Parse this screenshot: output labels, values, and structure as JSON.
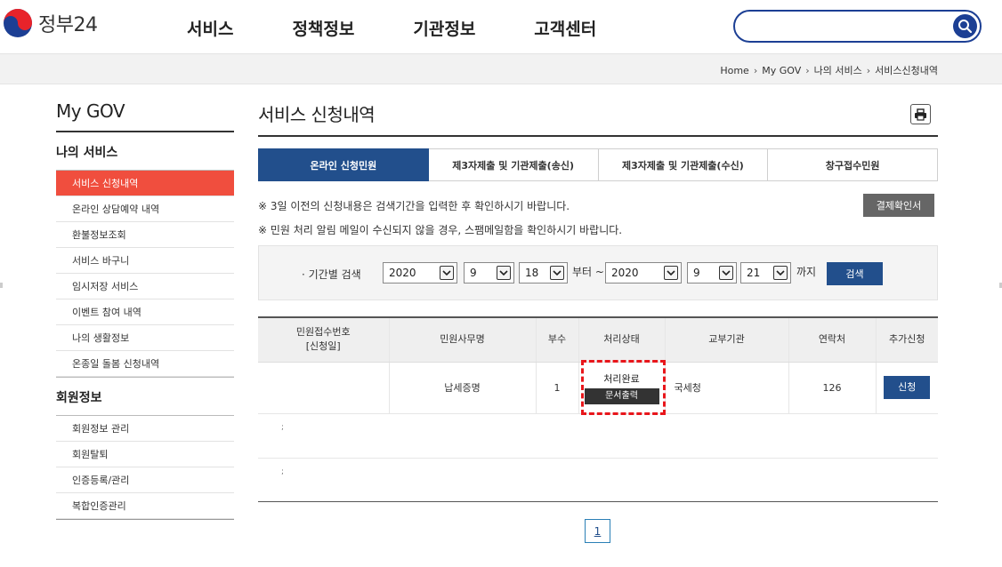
{
  "header": {
    "logo_text": "정부24",
    "nav": [
      "서비스",
      "정책정보",
      "기관정보",
      "고객센터"
    ],
    "search_placeholder": ""
  },
  "breadcrumb": [
    "Home",
    "My GOV",
    "나의 서비스",
    "서비스신청내역"
  ],
  "sidebar": {
    "title": "My GOV",
    "group1": "나의 서비스",
    "items": [
      "서비스 신청내역",
      "온라인 상담예약 내역",
      "환불정보조회",
      "서비스 바구니",
      "임시저장 서비스",
      "이벤트 참여 내역",
      "나의 생활정보",
      "온종일 돌봄 신청내역"
    ],
    "group2": "회원정보",
    "items2": [
      "회원정보 관리",
      "회원탈퇴",
      "인증등록/관리",
      "복합인증관리"
    ]
  },
  "main": {
    "title": "서비스 신청내역",
    "tabs": [
      "온라인 신청민원",
      "제3자제출 및 기관제출(송신)",
      "제3자제출 및 기관제출(수신)",
      "창구접수민원"
    ],
    "notice1": "※ 3일 이전의 신청내용은 검색기간을 입력한 후 확인하시기 바랍니다.",
    "notice2": "※ 민원 처리 알림 메일이 수신되지 않을 경우, 스팸메일함을 확인하시기 바랍니다.",
    "receipt_button": "결제확인서",
    "period": {
      "label": "· 기간별 검색",
      "from": {
        "year": "2020",
        "month": "9",
        "day": "18"
      },
      "to": {
        "year": "2020",
        "month": "9",
        "day": "21"
      },
      "from_suffix": "부터 ~",
      "to_suffix": "까지",
      "search_button": "검색"
    },
    "table": {
      "headers": {
        "receipt_no": "민원접수번호",
        "receipt_date": "[신청일]",
        "service": "민원사무명",
        "copies": "부수",
        "status": "처리상태",
        "agency": "교부기관",
        "contact": "연락처",
        "extra": "추가신청"
      },
      "rows": [
        {
          "receipt_no": "",
          "service": "납세증명",
          "copies": "1",
          "status": "처리완료",
          "print_label": "문서출력",
          "agency": "국세청",
          "contact": "126",
          "extra_button": "신청"
        }
      ]
    },
    "pagination": {
      "current": "1"
    }
  },
  "colors": {
    "brand_blue": "#224f8c",
    "active_red": "#f04e3e",
    "highlight_dashed": "#e8161b"
  }
}
